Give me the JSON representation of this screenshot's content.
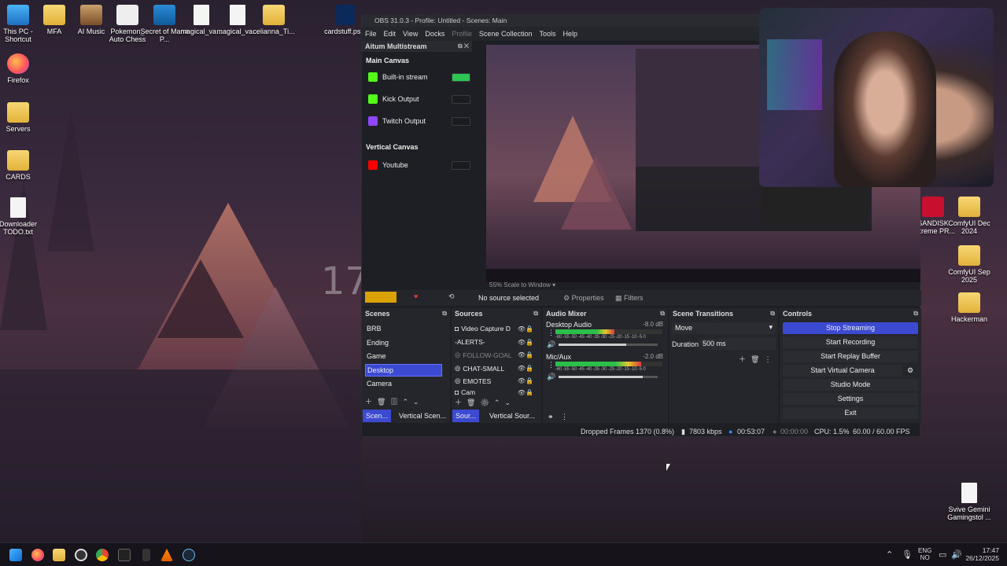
{
  "desktop": {
    "icons_left_top": [
      {
        "label": "This PC - Shortcut",
        "icon": "monitor-icon"
      },
      {
        "label": "MFA",
        "icon": "folder-icon"
      },
      {
        "label": "AI Music",
        "icon": "folder-icon"
      },
      {
        "label": "Pokemon_ Auto Chess",
        "icon": "game-icon"
      },
      {
        "label": "Secret of Mana P...",
        "icon": "game-icon"
      },
      {
        "label": "magical_va...",
        "icon": "document-icon"
      },
      {
        "label": "magical_va...",
        "icon": "document-icon"
      },
      {
        "label": "celianna_Ti...",
        "icon": "folder-icon"
      },
      {
        "label": "cardstuff.ps...",
        "icon": "photoshop-icon"
      }
    ],
    "icons_left_col": [
      {
        "label": "Firefox",
        "icon": "firefox-icon"
      },
      {
        "label": "Servers",
        "icon": "folder-icon"
      },
      {
        "label": "CARDS",
        "icon": "folder-icon"
      },
      {
        "label": "Downloader TODO.txt",
        "icon": "document-icon"
      }
    ],
    "icons_right": [
      {
        "label": "SANDISK Extreme PR...",
        "icon": "drive-icon"
      },
      {
        "label": "ComfyUI Dec 2024",
        "icon": "folder-icon"
      },
      {
        "label": "ComfyUI Sep 2025",
        "icon": "folder-icon"
      },
      {
        "label": "Hackerman",
        "icon": "folder-icon"
      },
      {
        "label": "Svive Gemini Gamingstol ...",
        "icon": "document-icon"
      }
    ],
    "wallpaper_text": "17"
  },
  "obs": {
    "title": "OBS 31.0.3 - Profile: Untitled - Scenes: Main",
    "menu": [
      "File",
      "Edit",
      "View",
      "Docks",
      "Profile",
      "Scene Collection",
      "Tools",
      "Help"
    ],
    "multistream": {
      "title": "Aitum Multistream",
      "main_canvas": "Main Canvas",
      "outputs": [
        {
          "label": "Built-in stream",
          "color": "#53fc18",
          "on": true
        },
        {
          "label": "Kick Output",
          "color": "#53fc18",
          "on": false
        },
        {
          "label": "Twitch Output",
          "color": "#9146ff",
          "on": false
        }
      ],
      "vertical_canvas": "Vertical Canvas",
      "vertical_outputs": [
        {
          "label": "Youtube",
          "color": "#ff0000",
          "on": false
        }
      ]
    },
    "preview": {
      "zoom": "55%",
      "scale": "Scale to Window"
    },
    "source_bar": {
      "none": "No source selected",
      "properties": "Properties",
      "filters": "Filters"
    },
    "scenes": {
      "title": "Scenes",
      "items": [
        "BRB",
        "Ending",
        "Game",
        "Desktop",
        "Camera"
      ],
      "selected": "Desktop"
    },
    "sources": {
      "title": "Sources",
      "items": [
        "Video Capture D",
        "-ALERTS-",
        "FOLLOW-GOAL",
        "CHAT-SMALL",
        "EMOTES",
        "Cam"
      ]
    },
    "mixer": {
      "title": "Audio Mixer",
      "channels": [
        {
          "name": "Desktop Audio",
          "db": "-8.0 dB",
          "level": 0.55,
          "volume": 0.68
        },
        {
          "name": "Mic/Aux",
          "db": "-2.0 dB",
          "level": 0.8,
          "volume": 0.85
        }
      ],
      "ticks": "-60 -55 -50 -45 -40 -35 -30 -25 -20 -15 -10 -5 0"
    },
    "transitions": {
      "title": "Scene Transitions",
      "type": "Move",
      "duration_label": "Duration",
      "duration": "500 ms"
    },
    "controls": {
      "title": "Controls",
      "buttons": [
        "Stop Streaming",
        "Start Recording",
        "Start Replay Buffer",
        "Start Virtual Camera",
        "Studio Mode",
        "Settings",
        "Exit"
      ]
    },
    "bottom_tabs": {
      "scenes": "Scen...",
      "vertical_scenes": "Vertical Scen...",
      "sources": "Sour...",
      "vertical_sources": "Vertical Sour..."
    },
    "status": {
      "dropped": "Dropped Frames 1370 (0.8%)",
      "kbps": "7803 kbps",
      "stream_time": "00:53:07",
      "rec_time": "00:00:00",
      "cpu": "CPU: 1.5%",
      "fps": "60.00 / 60.00 FPS"
    }
  },
  "taskbar": {
    "apps": [
      "windows-start-icon",
      "firefox-icon",
      "file-explorer-icon",
      "obs-icon",
      "chrome-icon",
      "terminal-icon",
      "pen-icon",
      "vlc-icon",
      "steam-icon"
    ],
    "lang": "ENG",
    "region": "NO",
    "time": "17:47",
    "date": "26/12/2025"
  }
}
